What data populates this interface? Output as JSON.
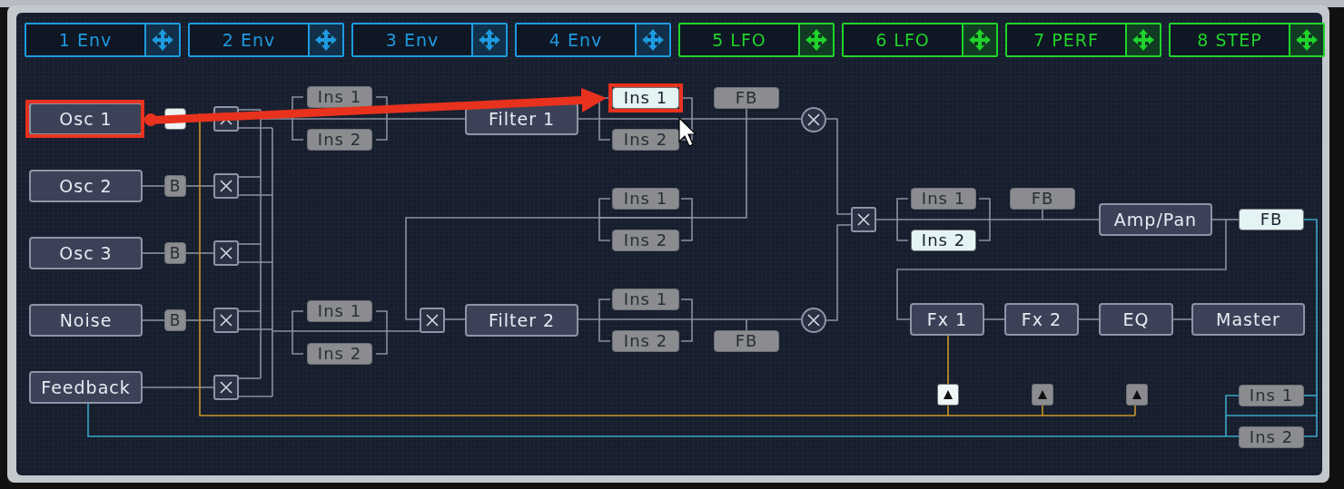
{
  "mod_slots": [
    {
      "label": "1 Env",
      "color": "#1e9be0"
    },
    {
      "label": "2 Env",
      "color": "#1e9be0"
    },
    {
      "label": "3 Env",
      "color": "#1e9be0"
    },
    {
      "label": "4 Env",
      "color": "#1e9be0"
    },
    {
      "label": "5 LFO",
      "color": "#1fd42a"
    },
    {
      "label": "6 LFO",
      "color": "#1fd42a"
    },
    {
      "label": "7 PERF",
      "color": "#1fd42a"
    },
    {
      "label": "8 STEP",
      "color": "#1fd42a"
    }
  ],
  "nodes": [
    {
      "kind": "module",
      "label": "Osc 1",
      "selected": false
    },
    {
      "kind": "bypass",
      "selected": true
    },
    {
      "kind": "mix",
      "selected": false
    },
    {
      "kind": "insert",
      "label": "Ins 1",
      "selected": false
    },
    {
      "kind": "insert",
      "label": "Ins 2",
      "selected": false
    },
    {
      "kind": "module",
      "label": "Filter 1",
      "selected": false
    },
    {
      "kind": "insert",
      "label": "Ins 1",
      "selected": true
    },
    {
      "kind": "insert",
      "label": "FB",
      "selected": false
    },
    {
      "kind": "insert",
      "label": "Ins 2",
      "selected": false
    },
    {
      "kind": "ring",
      "selected": false
    },
    {
      "kind": "module",
      "label": "Osc 2",
      "selected": false
    },
    {
      "kind": "bypass",
      "label": "B",
      "selected": false
    },
    {
      "kind": "mix",
      "selected": false
    },
    {
      "kind": "insert",
      "label": "Ins 1",
      "selected": false
    },
    {
      "kind": "insert",
      "label": "Ins 1",
      "selected": false
    },
    {
      "kind": "insert",
      "label": "FB",
      "selected": false
    },
    {
      "kind": "mix",
      "selected": false
    },
    {
      "kind": "module",
      "label": "Amp/Pan",
      "selected": false
    },
    {
      "kind": "insert",
      "label": "FB",
      "selected": true
    },
    {
      "kind": "insert",
      "label": "Ins 2",
      "selected": false
    },
    {
      "kind": "insert",
      "label": "Ins 2",
      "selected": true
    },
    {
      "kind": "module",
      "label": "Osc 3",
      "selected": false
    },
    {
      "kind": "bypass",
      "label": "B",
      "selected": false
    },
    {
      "kind": "mix",
      "selected": false
    },
    {
      "kind": "insert",
      "label": "Ins 1",
      "selected": false
    },
    {
      "kind": "insert",
      "label": "Ins 1",
      "selected": false
    },
    {
      "kind": "module",
      "label": "Noise",
      "selected": false
    },
    {
      "kind": "bypass",
      "label": "B",
      "selected": false
    },
    {
      "kind": "mix",
      "selected": false
    },
    {
      "kind": "mix",
      "selected": false
    },
    {
      "kind": "module",
      "label": "Filter 2",
      "selected": false
    },
    {
      "kind": "ring",
      "selected": false
    },
    {
      "kind": "module",
      "label": "Fx 1",
      "selected": false
    },
    {
      "kind": "module",
      "label": "Fx 2",
      "selected": false
    },
    {
      "kind": "module",
      "label": "EQ",
      "selected": false
    },
    {
      "kind": "module",
      "label": "Master",
      "selected": false
    },
    {
      "kind": "insert",
      "label": "Ins 2",
      "selected": false
    },
    {
      "kind": "insert",
      "label": "FB",
      "selected": false
    },
    {
      "kind": "insert",
      "label": "Ins 2",
      "selected": false
    },
    {
      "kind": "module",
      "label": "Feedback",
      "selected": false
    },
    {
      "kind": "mix",
      "selected": false
    },
    {
      "kind": "send",
      "selected": true
    },
    {
      "kind": "send",
      "selected": false
    },
    {
      "kind": "send",
      "selected": false
    },
    {
      "kind": "insert",
      "label": "Ins 1",
      "selected": false
    },
    {
      "kind": "insert",
      "label": "Ins 2",
      "selected": false
    }
  ]
}
